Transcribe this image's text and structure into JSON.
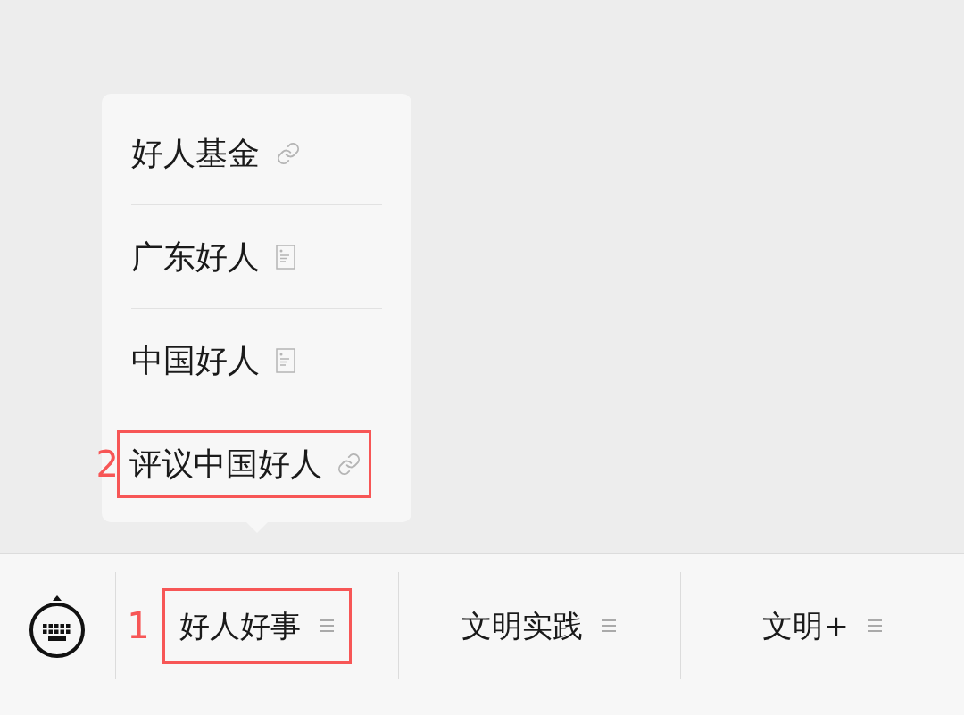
{
  "tab_bar": {
    "tabs": [
      {
        "label": "好人好事",
        "annotation": "1",
        "submenu": [
          {
            "label": "好人基金",
            "kind": "link"
          },
          {
            "label": "广东好人",
            "kind": "page"
          },
          {
            "label": "中国好人",
            "kind": "page"
          },
          {
            "label": "评议中国好人",
            "kind": "link",
            "annotation": "2"
          }
        ]
      },
      {
        "label": "文明实践"
      },
      {
        "label": "文明+"
      }
    ]
  }
}
